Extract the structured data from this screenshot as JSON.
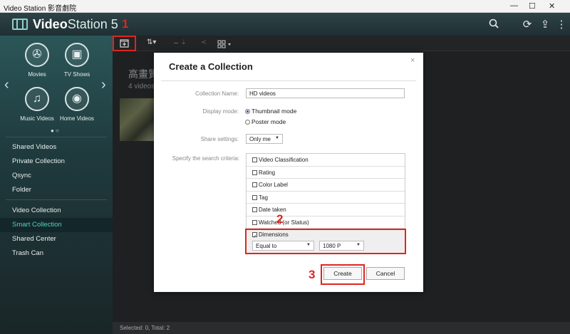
{
  "window": {
    "title": "Video Station 影音劇院",
    "min": "—",
    "max": "☐",
    "close": "✕"
  },
  "header": {
    "brand_bold": "Video",
    "brand_rest": "Station 5"
  },
  "header_icons": [
    "search-icon",
    "refresh-icon",
    "upload-icon",
    "more-icon"
  ],
  "sidebar": {
    "categories": [
      {
        "label": "Movies",
        "icon": "film-reel-icon"
      },
      {
        "label": "TV Shows",
        "icon": "tv-icon"
      },
      {
        "label": "Music Videos",
        "icon": "music-icon"
      },
      {
        "label": "Home Videos",
        "icon": "camera-icon"
      }
    ],
    "prev": "‹",
    "next": "›",
    "dots": "● ○",
    "nav_group1": [
      "Shared Videos",
      "Private Collection",
      "Qsync",
      "Folder"
    ],
    "nav_group2": [
      "Video Collection",
      "Smart Collection",
      "Shared Center",
      "Trash Can"
    ],
    "active": "Smart Collection"
  },
  "toolbar": {
    "sort": "⇅▾",
    "step1": "1"
  },
  "content": {
    "thumb_title": "高畫質",
    "thumb_count": "4 videos"
  },
  "status": {
    "text": "Selected: 0, Total: 2"
  },
  "dialog": {
    "title": "Create a Collection",
    "close": "×",
    "name_label": "Collection Name:",
    "name_value": "HD videos",
    "display_label": "Display mode:",
    "mode_thumbnail": "Thumbnail mode",
    "mode_poster": "Poster mode",
    "share_label": "Share settings:",
    "share_value": "Only me",
    "criteria_label": "Specify the search criteria:",
    "criteria": [
      "Video Classification",
      "Rating",
      "Color Label",
      "Tag",
      "Date taken",
      "Watched (or Status)",
      "Dimensions"
    ],
    "dim_operator": "Equal to",
    "dim_value": "1080 P",
    "create_label": "Create",
    "cancel_label": "Cancel",
    "step2": "2",
    "step3": "3"
  }
}
